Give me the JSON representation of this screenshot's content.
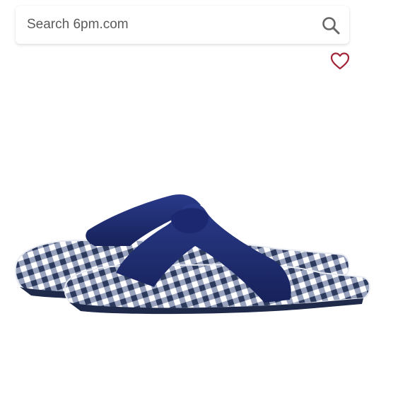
{
  "search": {
    "placeholder": "Search 6pm.com",
    "value": ""
  },
  "icons": {
    "search": "search-icon",
    "favorite": "heart-outline-icon"
  },
  "colors": {
    "heart_accent": "#a3253a",
    "strap_navy": "#1f2b6b",
    "gingham_navy": "#2c3a5e",
    "icon_gray": "#666666"
  }
}
